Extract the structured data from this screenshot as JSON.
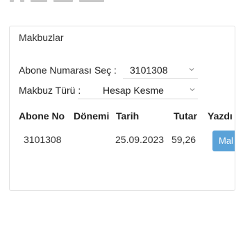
{
  "panel": {
    "title": "Makbuzlar"
  },
  "form": {
    "subscriber_label": "Abone Numarası Seç :",
    "subscriber_value": "3101308",
    "receipt_type_label": "Makbuz Türü :",
    "receipt_type_value": "Hesap Kesme"
  },
  "table": {
    "headers": [
      "Abone No",
      "Dönemi",
      "Tarih",
      "Tutar",
      "Yazdı"
    ],
    "rows": [
      {
        "abone_no": "3101308",
        "donemi": "",
        "tarih": "25.09.2023",
        "tutar": "59,26",
        "action": "Mal"
      }
    ]
  },
  "icons": {
    "dropdown": "chevron-down-icon"
  },
  "colors": {
    "accent": "#5aa2d8",
    "border": "#e3e3e3"
  }
}
